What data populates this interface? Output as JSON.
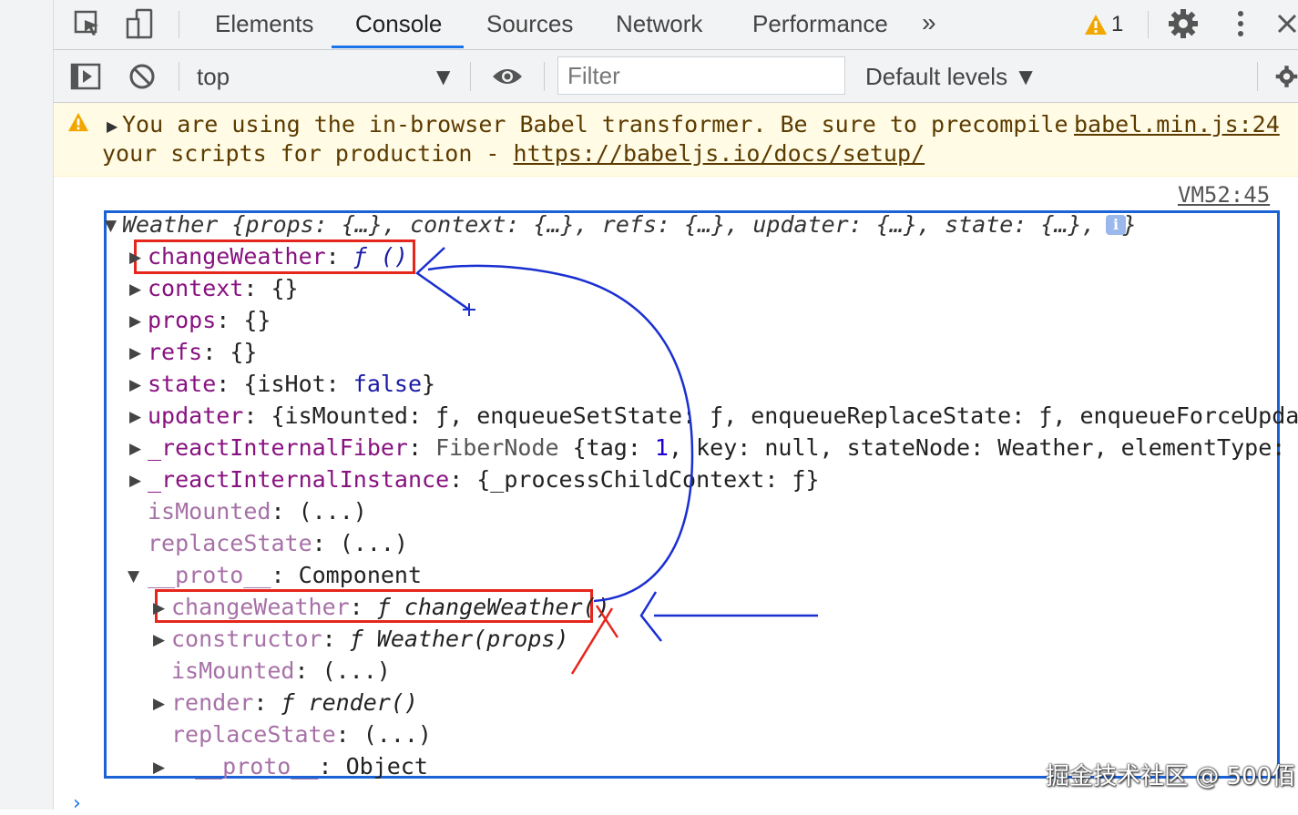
{
  "tabs": {
    "elements": "Elements",
    "console": "Console",
    "sources": "Sources",
    "network": "Network",
    "performance": "Performance",
    "more": "»",
    "warning_count": "1"
  },
  "toolbar": {
    "context": "top",
    "filter_placeholder": "Filter",
    "levels": "Default levels ▼"
  },
  "warning": {
    "line1": "You are using the in-browser Babel transformer. Be sure to precompile",
    "line2_prefix": "your scripts for production - ",
    "link": "https://babeljs.io/docs/setup/",
    "source": "babel.min.js:24"
  },
  "log": {
    "source": "VM52:45",
    "summary": "Weather {props: {…}, context: {…}, refs: {…}, updater: {…}, state: {…}, …}",
    "rows": {
      "changeWeather": {
        "key": "changeWeather",
        "sep": ": ",
        "val": "ƒ ()"
      },
      "context": {
        "key": "context",
        "sep": ": ",
        "val": "{}"
      },
      "props": {
        "key": "props",
        "sep": ": ",
        "val": "{}"
      },
      "refs": {
        "key": "refs",
        "sep": ": ",
        "val": "{}"
      },
      "state": {
        "key": "state",
        "pre": ": {isHot: ",
        "val": "false",
        "post": "}"
      },
      "updater": {
        "key": "updater",
        "val": ": {isMounted: ƒ, enqueueSetState: ƒ, enqueueReplaceState: ƒ, enqueueForceUpdat…"
      },
      "fiber": {
        "key": "_reactInternalFiber",
        "sep": ": ",
        "type": "FiberNode",
        "pre": " {tag: ",
        "num": "1",
        "post": ", key: null, stateNode: Weather, elementType: ƒ…"
      },
      "instance": {
        "key": "_reactInternalInstance",
        "val": ": {_processChildContext: ƒ}"
      },
      "isMounted": {
        "key": "isMounted",
        "val": ": (...)"
      },
      "replaceState": {
        "key": "replaceState",
        "val": ": (...)"
      },
      "proto": {
        "key": "__proto__",
        "val": ": Component"
      },
      "proto_changeWeather": {
        "key": "changeWeather",
        "sep": ": ",
        "val": "ƒ changeWeather()"
      },
      "proto_constructor": {
        "key": "constructor",
        "sep": ": ",
        "val": "ƒ Weather(props)"
      },
      "proto_isMounted": {
        "key": "isMounted",
        "val": ": (...)"
      },
      "proto_render": {
        "key": "render",
        "sep": ": ",
        "val": "ƒ render()"
      },
      "proto_replaceState": {
        "key": "replaceState",
        "val": ": (...)"
      },
      "proto_proto": {
        "key": "__proto__",
        "val": ": Object"
      }
    }
  },
  "watermark": "掘金技术社区 @ 500佰",
  "prompt": "›",
  "colors": {
    "accent": "#1a73e8",
    "frame": "#1a62d6",
    "highlight": "#e5261c",
    "key": "#881280",
    "keyword": "#1a1aa6",
    "warning_bg": "#fffbe5"
  }
}
